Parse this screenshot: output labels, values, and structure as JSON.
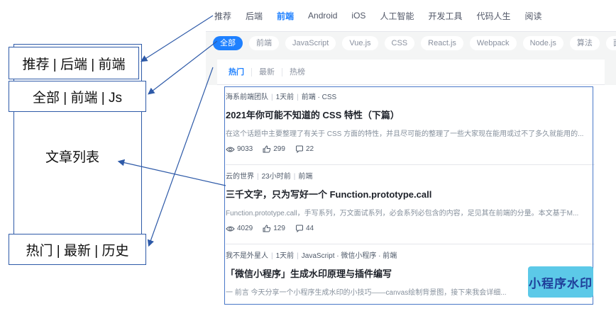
{
  "topnav": {
    "items": [
      "推荐",
      "后端",
      "前端",
      "Android",
      "iOS",
      "人工智能",
      "开发工具",
      "代码人生",
      "阅读"
    ],
    "active_index": 2
  },
  "tags": {
    "items": [
      "全部",
      "前端",
      "JavaScript",
      "Vue.js",
      "CSS",
      "React.js",
      "Webpack",
      "Node.js",
      "算法",
      "面试"
    ],
    "active_index": 0
  },
  "subtabs": {
    "items": [
      "热门",
      "最新",
      "热榜"
    ],
    "active_index": 0
  },
  "articles": [
    {
      "author": "海系前端团队",
      "time": "1天前",
      "tags": "前端 · CSS",
      "title": "2021年你可能不知道的 CSS 特性（下篇）",
      "desc": "在这个话题中主要整理了有关于 CSS 方面的特性，并且尽可能的整理了一些大家现在能用或过不了多久就能用的...",
      "views": "9033",
      "likes": "299",
      "comments": "22"
    },
    {
      "author": "云的世界",
      "time": "23小时前",
      "tags": "前端",
      "title": "三千文字，只为写好一个 Function.prototype.call",
      "desc": "Function.prototype.call，手写系列，万文面试系列，必会系列必包含的内容，足见其在前端的分量。本文基于M...",
      "views": "4029",
      "likes": "129",
      "comments": "44"
    },
    {
      "author": "我不是外星人",
      "time": "1天前",
      "tags": "JavaScript · 微信小程序 · 前端",
      "title": "「微信小程序」生成水印原理与插件编写",
      "desc": "一 前言 今天分享一个小程序生成水印的小技巧——canvas绘制背景图，接下来我会详细..."
    }
  ],
  "annotations": {
    "label1": "推荐 | 后端 | 前端",
    "label2": "全部 | 前端 | Js",
    "label3": "文章列表",
    "label4": "热门 | 最新 | 历史"
  },
  "watermark": "小程序水印",
  "colors": {
    "accent": "#1e80ff",
    "annotation_blue": "#2e5aa8",
    "watermark_bg": "#5cc9e8"
  }
}
